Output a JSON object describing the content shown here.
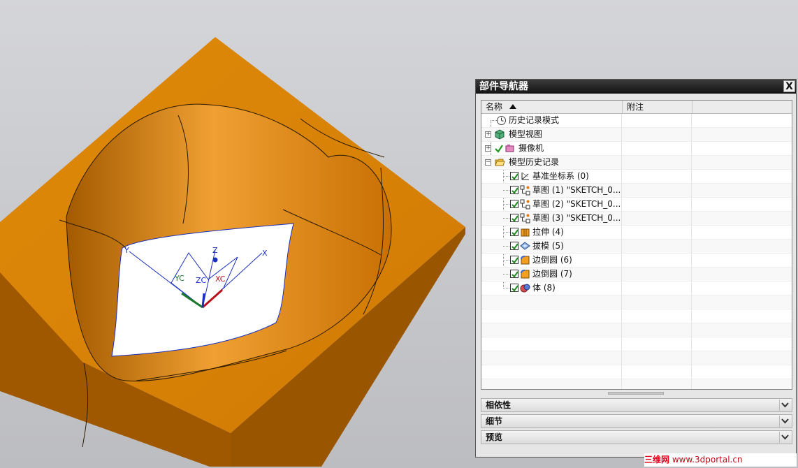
{
  "navigator": {
    "title": "部件导航器",
    "close_label": "X",
    "columns": {
      "name": "名称",
      "note": "附注"
    },
    "rows": [
      {
        "label": "历史记录模式",
        "icon": "clock-icon"
      },
      {
        "label": "模型视图",
        "icon": "model-views-icon"
      },
      {
        "label": "摄像机",
        "icon": "camera-icon"
      },
      {
        "label": "模型历史记录",
        "icon": "folder-open-icon"
      },
      {
        "label": "基准坐标系 (0)",
        "icon": "datum-csys-icon"
      },
      {
        "label": "草图 (1) \"SKETCH_0...",
        "icon": "sketch-icon"
      },
      {
        "label": "草图 (2) \"SKETCH_0...",
        "icon": "sketch-icon"
      },
      {
        "label": "草图 (3) \"SKETCH_0...",
        "icon": "sketch-icon"
      },
      {
        "label": "拉伸 (4)",
        "icon": "extrude-icon"
      },
      {
        "label": "拔模 (5)",
        "icon": "draft-icon"
      },
      {
        "label": "边倒圆 (6)",
        "icon": "edge-blend-icon"
      },
      {
        "label": "边倒圆 (7)",
        "icon": "edge-blend-icon"
      },
      {
        "label": "体 (8)",
        "icon": "body-icon"
      }
    ],
    "panels": {
      "dependencies": "相依性",
      "details": "细节",
      "preview": "预览"
    }
  },
  "viewport": {
    "axis_labels": {
      "x": "X",
      "y": "Y",
      "z": "Z",
      "xc": "XC",
      "yc": "YC",
      "zc": "ZC"
    },
    "colors": {
      "model": "#d77f05",
      "model_shadow": "#a35a00",
      "background": "#c7c8cc"
    }
  },
  "watermark": {
    "part_a": "三维网",
    "part_b": "www.3dportal.cn"
  }
}
